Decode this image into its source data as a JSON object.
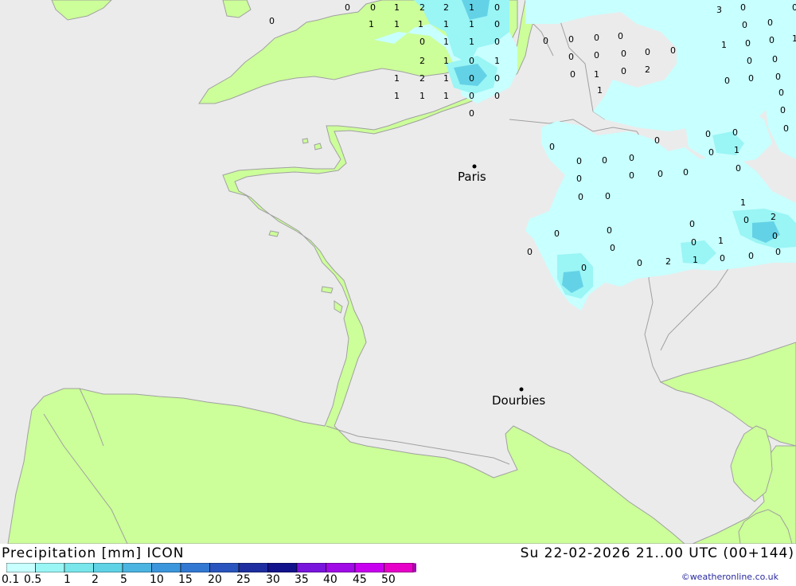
{
  "header": {
    "product": "Precipitation [mm] ICON",
    "valid_time": "Su 22-02-2026 21..00 UTC (00+144)"
  },
  "credit": "©weatheronline.co.uk",
  "legend": {
    "ticks": [
      "0.1",
      "0.5",
      "1",
      "2",
      "5",
      "10",
      "15",
      "20",
      "25",
      "30",
      "35",
      "40",
      "45",
      "50"
    ],
    "colors": [
      "#c8ffff",
      "#9af5f5",
      "#78e6eb",
      "#5fd2e6",
      "#4bb4e1",
      "#3c96dc",
      "#3278d2",
      "#2a55be",
      "#1e2ea0",
      "#12128c",
      "#7814dc",
      "#a00ae6",
      "#c800f0",
      "#e600c8",
      "#a00ab4"
    ]
  },
  "colors": {
    "sea": "#ebebeb",
    "land": "#ccff99",
    "coast": "#a0a0a0",
    "precip_light": "#c8ffff",
    "precip_medium": "#9af5f5",
    "precip_heavy": "#64d2e6"
  },
  "cities": [
    {
      "name": "Paris"
    },
    {
      "name": "Dourbies"
    }
  ],
  "precip_values": [
    "0",
    "0",
    "0",
    "1",
    "2",
    "2",
    "1",
    "0",
    "1",
    "1",
    "1",
    "1",
    "1",
    "0",
    "0",
    "1",
    "1",
    "0",
    "2",
    "1",
    "0",
    "1",
    "1",
    "2",
    "1",
    "0",
    "0",
    "1",
    "1",
    "1",
    "0",
    "0",
    "0",
    "0",
    "0",
    "0",
    "0",
    "0",
    "0",
    "0",
    "0",
    "0",
    "0",
    "1",
    "0",
    "2",
    "1",
    "3",
    "0",
    "0",
    "0",
    "0",
    "0",
    "1",
    "1",
    "0",
    "0",
    "0",
    "0",
    "0",
    "0",
    "0",
    "0",
    "0",
    "0",
    "0",
    "0",
    "0",
    "0",
    "0",
    "0",
    "0",
    "0",
    "0",
    "0",
    "0",
    "1",
    "0",
    "0",
    "0",
    "1",
    "2",
    "0",
    "0",
    "0",
    "0",
    "0",
    "0",
    "1",
    "0",
    "0",
    "0",
    "0",
    "0",
    "2",
    "1",
    "0",
    "0"
  ]
}
